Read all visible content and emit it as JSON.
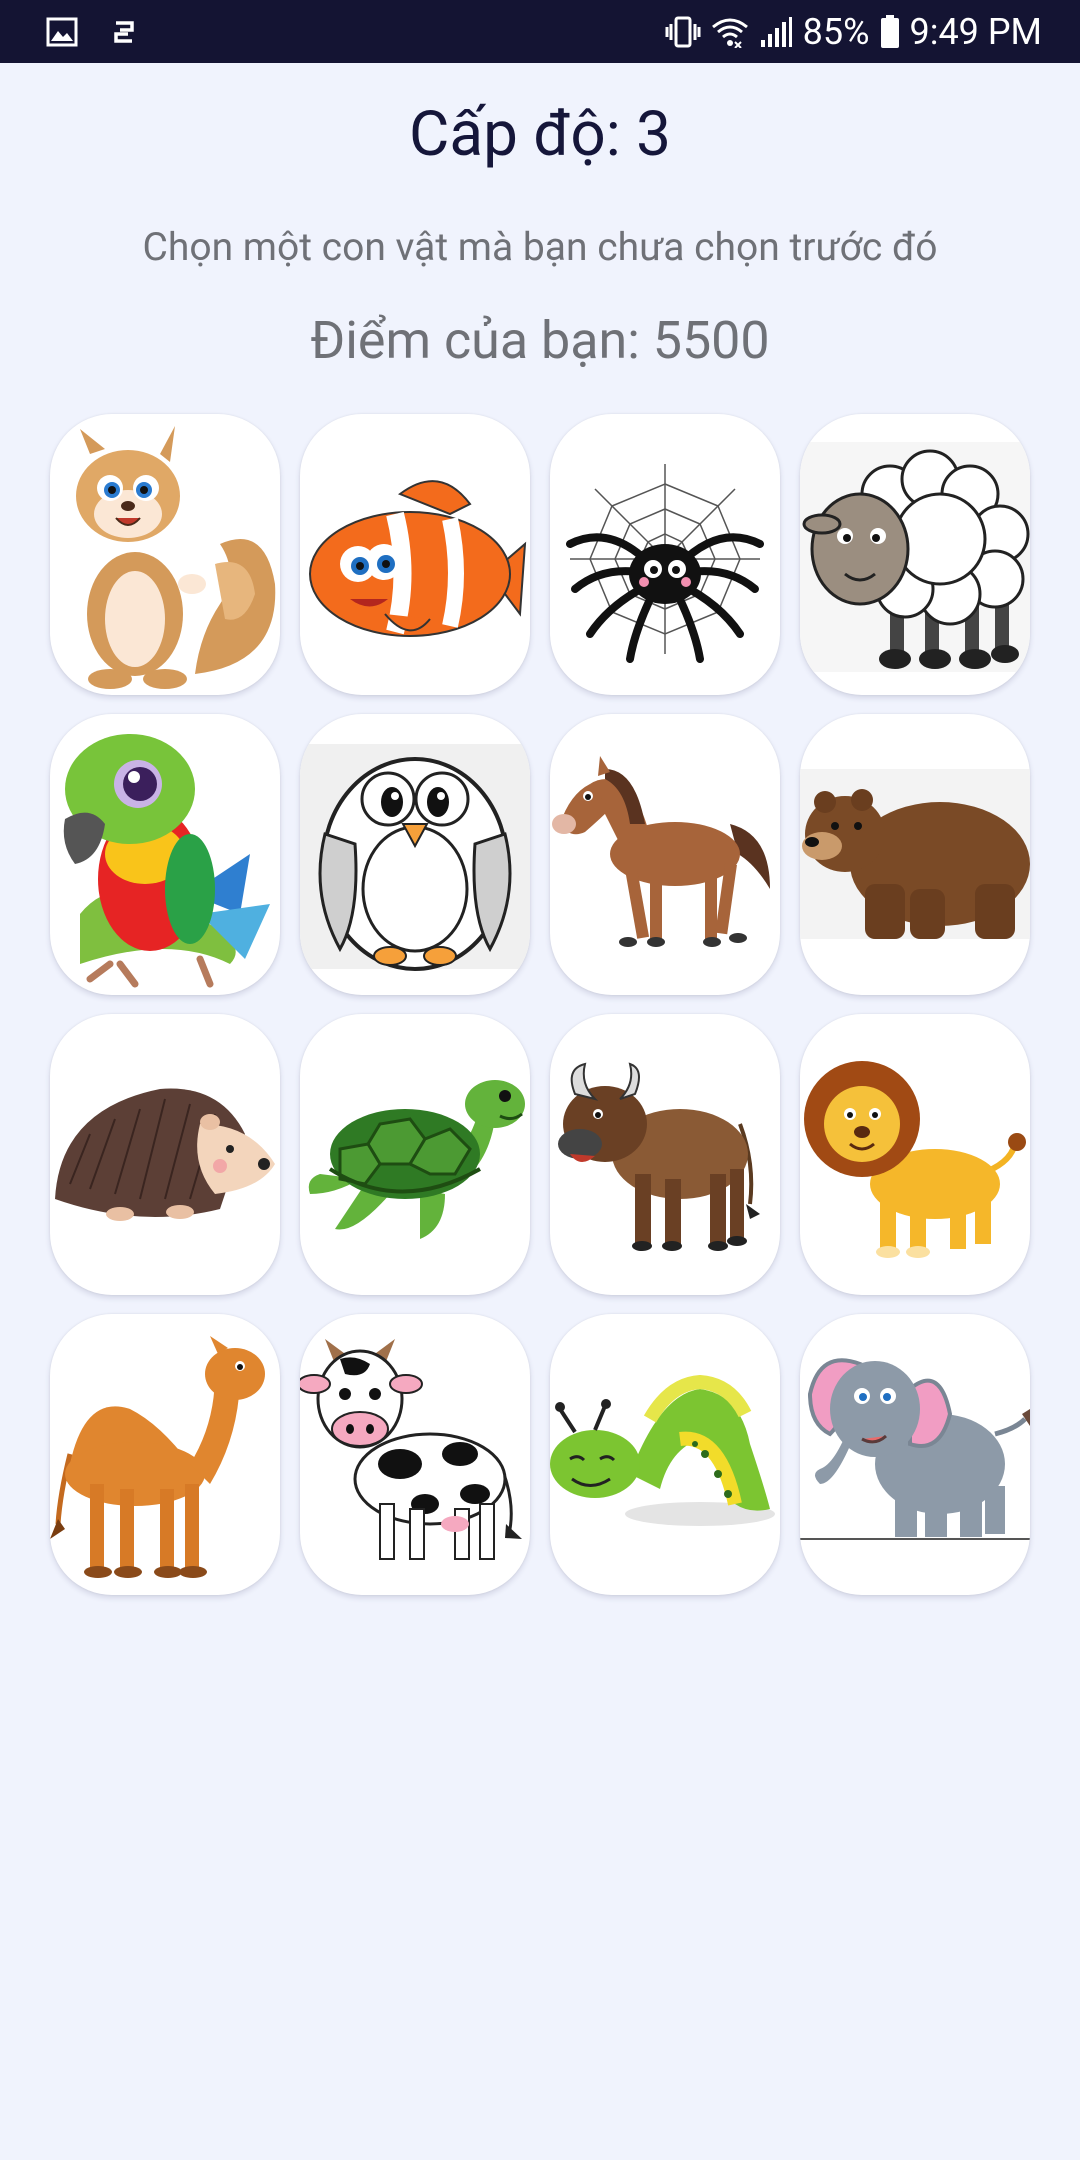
{
  "status_bar": {
    "battery_percent": "85%",
    "time": "9:49 PM",
    "icons": [
      "image-icon",
      "sync-icon",
      "vibrate-icon",
      "wifi-icon",
      "signal-icon",
      "battery-icon"
    ]
  },
  "game": {
    "level_text": "Cấp độ: 3",
    "instruction": "Chọn một con vật mà bạn chưa chọn trước đó",
    "score_text": "Điểm của bạn: 5500"
  },
  "animals": [
    {
      "name": "squirrel"
    },
    {
      "name": "clownfish"
    },
    {
      "name": "spider"
    },
    {
      "name": "sheep"
    },
    {
      "name": "parrot"
    },
    {
      "name": "owl"
    },
    {
      "name": "horse"
    },
    {
      "name": "bear"
    },
    {
      "name": "hedgehog"
    },
    {
      "name": "turtle"
    },
    {
      "name": "buffalo"
    },
    {
      "name": "lion"
    },
    {
      "name": "camel"
    },
    {
      "name": "cow"
    },
    {
      "name": "caterpillar"
    },
    {
      "name": "elephant"
    }
  ]
}
